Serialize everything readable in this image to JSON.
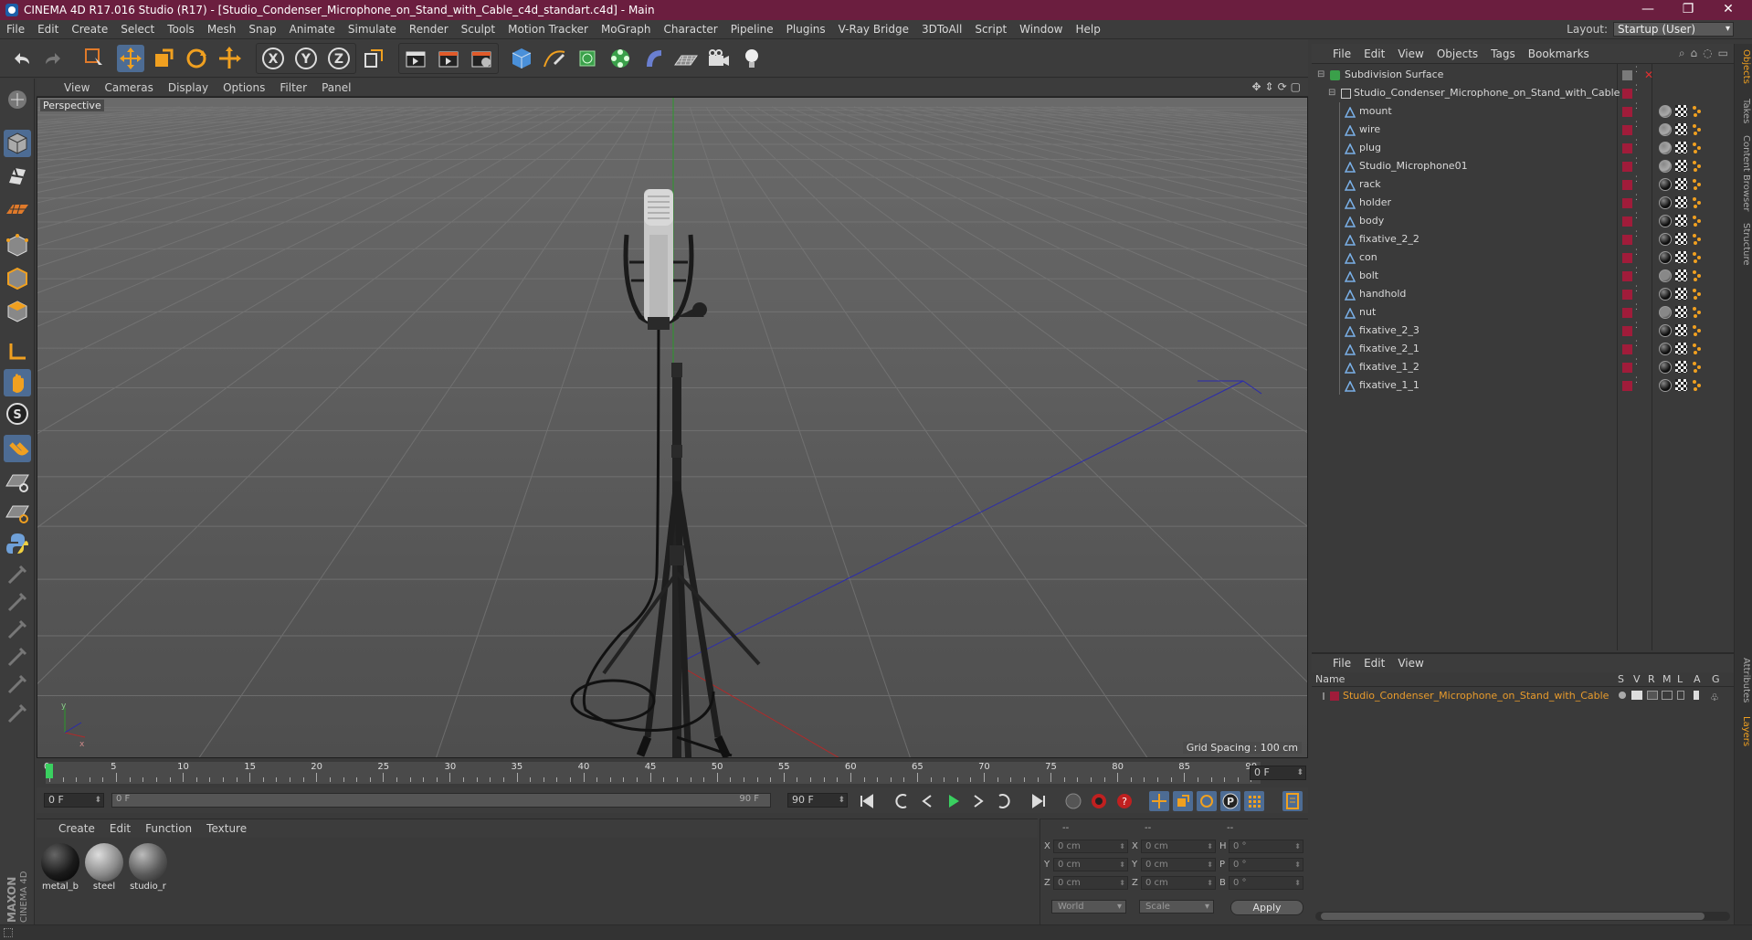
{
  "titlebar": {
    "title": "CINEMA 4D R17.016 Studio (R17) - [Studio_Condenser_Microphone_on_Stand_with_Cable_c4d_standart.c4d] - Main",
    "minimize": "—",
    "restore": "❐",
    "close": "✕"
  },
  "menubar": {
    "items": [
      "File",
      "Edit",
      "Create",
      "Select",
      "Tools",
      "Mesh",
      "Snap",
      "Animate",
      "Simulate",
      "Render",
      "Sculpt",
      "Motion Tracker",
      "MoGraph",
      "Character",
      "Pipeline",
      "Plugins",
      "V-Ray Bridge",
      "3DToAll",
      "Script",
      "Window",
      "Help"
    ],
    "layout_label": "Layout:",
    "layout_value": "Startup (User)"
  },
  "viewport": {
    "menu": [
      "View",
      "Cameras",
      "Display",
      "Options",
      "Filter",
      "Panel"
    ],
    "label": "Perspective",
    "grid_spacing": "Grid Spacing : 100 cm"
  },
  "timeline": {
    "ticks": [
      "0",
      "5",
      "10",
      "15",
      "20",
      "25",
      "30",
      "35",
      "40",
      "45",
      "50",
      "55",
      "60",
      "65",
      "70",
      "75",
      "80",
      "85",
      "90"
    ],
    "current_frame": "0 F",
    "start_frame": "0 F",
    "range_start": "0 F",
    "range_end": "90 F",
    "end_frame": "90 F"
  },
  "materials": {
    "menu": [
      "Create",
      "Edit",
      "Function",
      "Texture"
    ],
    "items": [
      {
        "name": "metal_b",
        "color": "#1a1a1a"
      },
      {
        "name": "steel",
        "color": "#8a8a8a"
      },
      {
        "name": "studio_r",
        "color": "#5a5a5a"
      }
    ]
  },
  "coords": {
    "headers": [
      "--",
      "--",
      "--"
    ],
    "rows": [
      {
        "l1": "X",
        "v1": "0 cm",
        "l2": "X",
        "v2": "0 cm",
        "l3": "H",
        "v3": "0 °"
      },
      {
        "l1": "Y",
        "v1": "0 cm",
        "l2": "Y",
        "v2": "0 cm",
        "l3": "P",
        "v3": "0 °"
      },
      {
        "l1": "Z",
        "v1": "0 cm",
        "l2": "Z",
        "v2": "0 cm",
        "l3": "B",
        "v3": "0 °"
      }
    ],
    "mode1": "World",
    "mode2": "Scale",
    "apply": "Apply"
  },
  "objects": {
    "menu": [
      "File",
      "Edit",
      "View",
      "Objects",
      "Tags",
      "Bookmarks"
    ],
    "root": "Subdivision Surface",
    "group": "Studio_Condenser_Microphone_on_Stand_with_Cable",
    "children": [
      "mount",
      "wire",
      "plug",
      "Studio_Microphone01",
      "rack",
      "holder",
      "body",
      "fixative_2_2",
      "con",
      "bolt",
      "handhold",
      "nut",
      "fixative_2_3",
      "fixative_2_1",
      "fixative_1_2",
      "fixative_1_1"
    ]
  },
  "layers": {
    "menu": [
      "File",
      "Edit",
      "View"
    ],
    "name_header": "Name",
    "flags": [
      "S",
      "V",
      "R",
      "M",
      "L",
      "A",
      "G"
    ],
    "row": "Studio_Condenser_Microphone_on_Stand_with_Cable"
  },
  "sidetabs": [
    "Objects",
    "Takes",
    "Content Browser",
    "Structure",
    "Attributes",
    "Layers"
  ],
  "brand": {
    "line1": "MAXON",
    "line2": "CINEMA 4D"
  },
  "colors": {
    "accent": "#4d6c94",
    "title": "#6b1e3f",
    "layer_name": "#e89b2c",
    "layer_color": "#a01c3a"
  }
}
